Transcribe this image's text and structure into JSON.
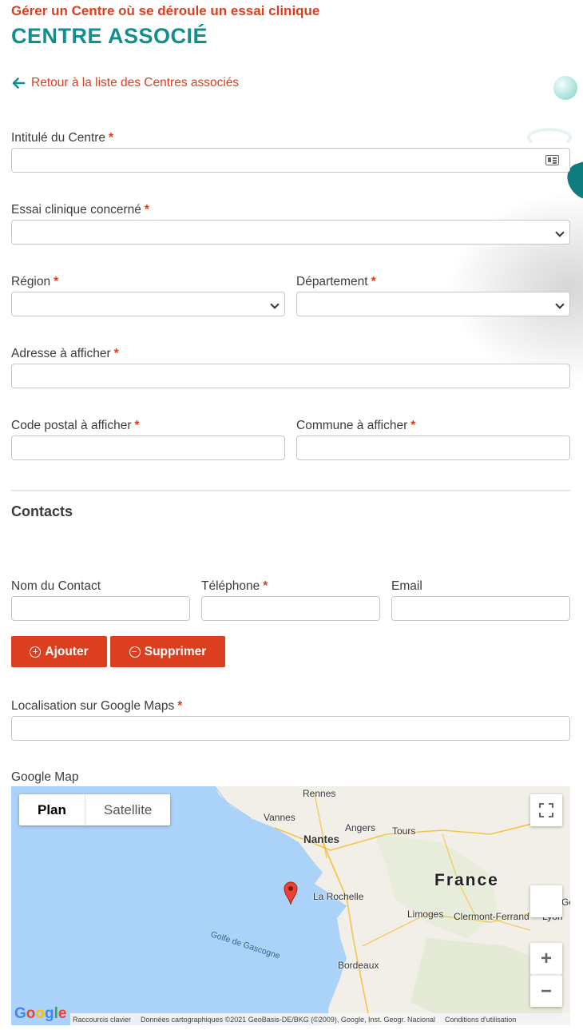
{
  "header": {
    "subtitle": "Gérer un Centre où se déroule un essai clinique",
    "title": "CENTRE ASSOCIÉ"
  },
  "back_link": {
    "label": "Retour à la liste des Centres associés"
  },
  "required_mark": "*",
  "fields": {
    "intitule": {
      "label": "Intitulé du Centre",
      "value": ""
    },
    "essai": {
      "label": "Essai clinique concerné",
      "value": ""
    },
    "region": {
      "label": "Région",
      "value": ""
    },
    "departement": {
      "label": "Département",
      "value": ""
    },
    "adresse": {
      "label": "Adresse à afficher",
      "value": ""
    },
    "code_postal": {
      "label": "Code postal à afficher",
      "value": ""
    },
    "commune": {
      "label": "Commune à afficher",
      "value": ""
    }
  },
  "contacts": {
    "section_title": "Contacts",
    "nom_label": "Nom du Contact",
    "telephone_label": "Téléphone",
    "email_label": "Email",
    "add_label": "Ajouter",
    "remove_label": "Supprimer"
  },
  "localisation": {
    "label": "Localisation sur Google Maps",
    "value": ""
  },
  "map": {
    "label": "Google Map",
    "type_plan": "Plan",
    "type_satellite": "Satellite",
    "country": "France",
    "sea": "Golfe de Gascogne",
    "cities": {
      "rennes": "Rennes",
      "vannes": "Vannes",
      "angers": "Angers",
      "tours": "Tours",
      "nantes": "Nantes",
      "la_rochelle": "La Rochelle",
      "limoges": "Limoges",
      "clermont": "Clermont-Ferrand",
      "lyon": "Lyon",
      "bordeaux": "Bordeaux",
      "ge": "Ge"
    },
    "logo": "Google",
    "shortcuts": "Raccourcis clavier",
    "attribution": "Données cartographiques ©2021 GeoBasis-DE/BKG (©2009), Google, Inst. Geogr. Nacional",
    "terms": "Conditions d'utilisation",
    "zoom_in": "+",
    "zoom_out": "−"
  },
  "colors": {
    "accent": "#db3f1f",
    "title": "#0f8f8f",
    "water": "#abd3f9",
    "land": "#f2efe9"
  }
}
